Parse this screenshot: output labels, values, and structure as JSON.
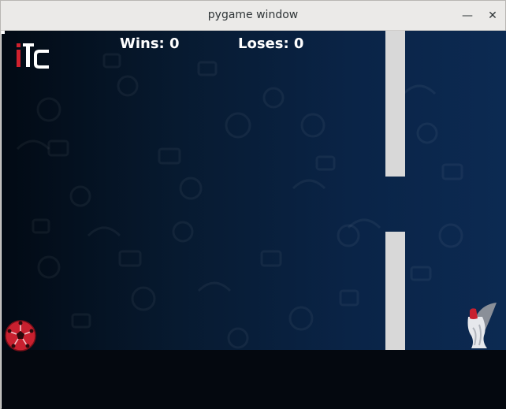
{
  "window": {
    "title": "pygame window",
    "minimize_glyph": "—",
    "close_glyph": "✕"
  },
  "hud": {
    "wins": "Wins: 0",
    "loses": "Loses: 0"
  },
  "sprites": {
    "logo_icon": "itc-logo-icon",
    "player_icon": "soccer-ball-icon",
    "goal_icon": "world-cup-trophy-icon"
  },
  "colors": {
    "pipe": "#d8d8d8",
    "ball": "#c8202f",
    "hud_text": "#ffffff",
    "ground": "#04080f"
  }
}
